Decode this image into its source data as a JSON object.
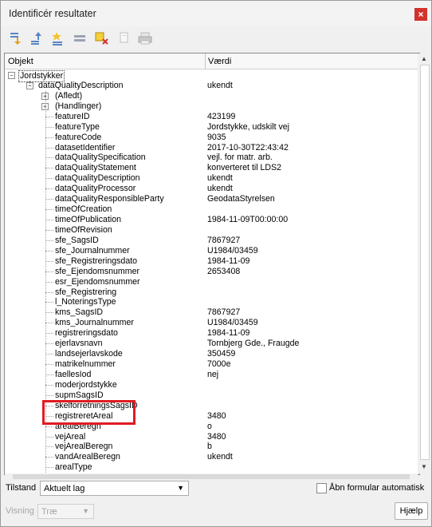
{
  "window": {
    "title": "Identificér resultater",
    "close_glyph": "×"
  },
  "toolbar": {
    "icons": [
      "expand-all-icon",
      "collapse-all-icon",
      "expand-new-icon",
      "clear-results-icon",
      "clear-highlights-icon",
      "copy-icon",
      "print-icon"
    ]
  },
  "tree": {
    "columns": [
      "Objekt",
      "Værdi"
    ],
    "root": "Jordstykker",
    "node": {
      "key": "dataQualityDescription",
      "value": "ukendt"
    },
    "groups": [
      "(Afledt)",
      "(Handlinger)"
    ],
    "rows": [
      {
        "key": "featureID",
        "value": "423199"
      },
      {
        "key": "featureType",
        "value": "Jordstykke, udskilt vej"
      },
      {
        "key": "featureCode",
        "value": "9035"
      },
      {
        "key": "datasetIdentifier",
        "value": "2017-10-30T22:43:42"
      },
      {
        "key": "dataQualitySpecification",
        "value": "vejl. for matr. arb."
      },
      {
        "key": "dataQualityStatement",
        "value": "konverteret til LDS2"
      },
      {
        "key": "dataQualityDescription",
        "value": "ukendt"
      },
      {
        "key": "dataQualityProcessor",
        "value": "ukendt"
      },
      {
        "key": "dataQualityResponsibleParty",
        "value": "GeodataStyrelsen"
      },
      {
        "key": "timeOfCreation",
        "value": ""
      },
      {
        "key": "timeOfPublication",
        "value": "1984-11-09T00:00:00"
      },
      {
        "key": "timeOfRevision",
        "value": ""
      },
      {
        "key": "sfe_SagsID",
        "value": "7867927"
      },
      {
        "key": "sfe_Journalnummer",
        "value": "U1984/03459"
      },
      {
        "key": "sfe_Registreringsdato",
        "value": "1984-11-09"
      },
      {
        "key": "sfe_Ejendomsnummer",
        "value": "2653408"
      },
      {
        "key": "esr_Ejendomsnummer",
        "value": ""
      },
      {
        "key": "sfe_Registrering",
        "value": ""
      },
      {
        "key": "l_NoteringsType",
        "value": ""
      },
      {
        "key": "kms_SagsID",
        "value": "7867927"
      },
      {
        "key": "kms_Journalnummer",
        "value": "U1984/03459"
      },
      {
        "key": "registreringsdato",
        "value": "1984-11-09"
      },
      {
        "key": "ejerlavsnavn",
        "value": "Tornbjerg Gde., Fraugde"
      },
      {
        "key": "landsejerlavskode",
        "value": "350459"
      },
      {
        "key": "matrikelnummer",
        "value": "7000e"
      },
      {
        "key": "faellesIod",
        "value": "nej"
      },
      {
        "key": "moderjordstykke",
        "value": ""
      },
      {
        "key": "supmSagsID",
        "value": ""
      },
      {
        "key": "skelforretningsSagsID",
        "value": ""
      },
      {
        "key": "registreretAreal",
        "value": "3480"
      },
      {
        "key": "arealBeregn",
        "value": "o"
      },
      {
        "key": "vejAreal",
        "value": "3480"
      },
      {
        "key": "vejArealBeregn",
        "value": "b"
      },
      {
        "key": "vandArealBeregn",
        "value": "ukendt"
      },
      {
        "key": "arealType",
        "value": ""
      }
    ]
  },
  "footer": {
    "mode_label": "Tilstand",
    "mode_value": "Aktuelt lag",
    "auto_open_label": "Åbn formular automatisk",
    "view_label": "Visning",
    "view_value": "Træ",
    "help_button": "Hjælp"
  },
  "colors": {
    "highlight_box": "#e11b22",
    "close_button": "#d2322d"
  }
}
